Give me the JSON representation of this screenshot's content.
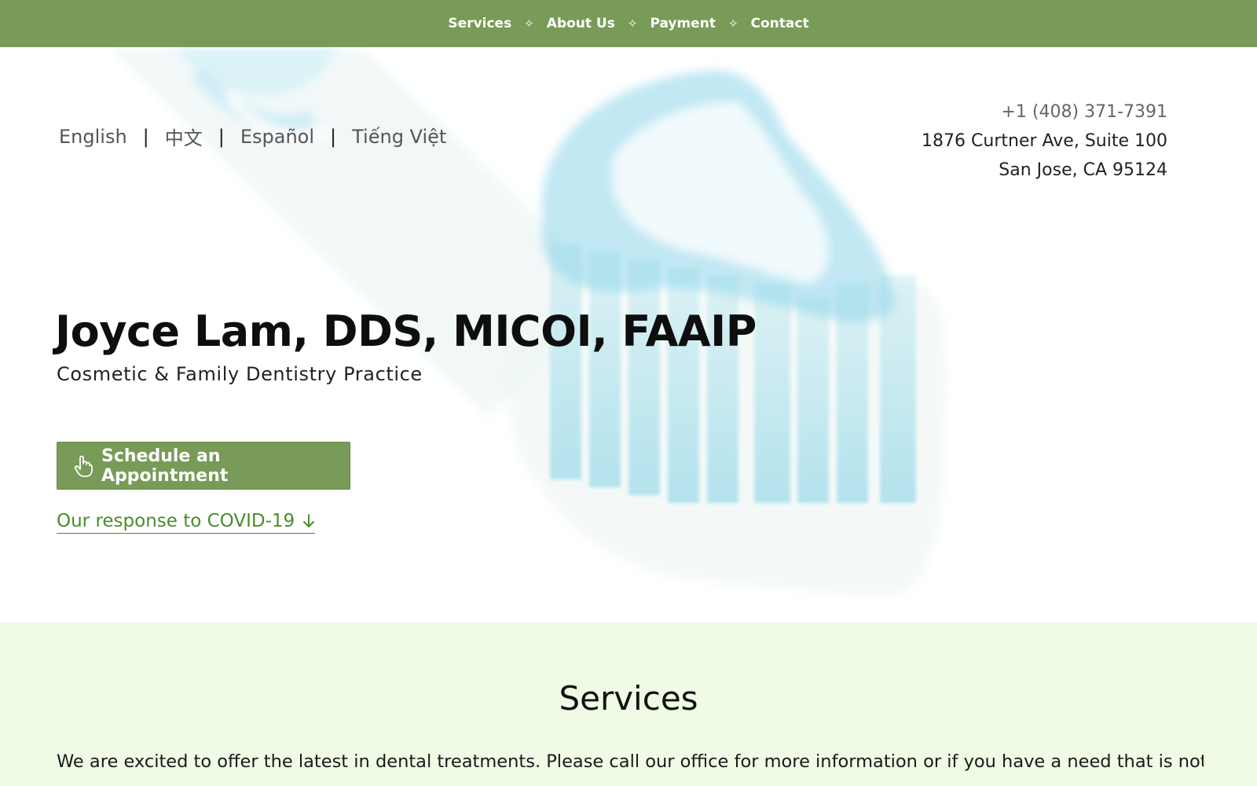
{
  "nav": {
    "items": [
      {
        "label": "Services"
      },
      {
        "label": "About Us"
      },
      {
        "label": "Payment"
      },
      {
        "label": "Contact"
      }
    ],
    "separator": "✧"
  },
  "languages": {
    "items": [
      {
        "label": "English"
      },
      {
        "label": "中文"
      },
      {
        "label": "Español"
      },
      {
        "label": "Tiếng Việt"
      }
    ],
    "separator": "|"
  },
  "contact": {
    "phone": "+1 (408) 371-7391",
    "address_line1": "1876 Curtner Ave, Suite 100",
    "address_line2": "San Jose, CA 95124"
  },
  "hero": {
    "title": "Joyce Lam, DDS, MICOI, FAAIP",
    "subtitle": "Cosmetic & Family Dentistry Practice",
    "cta_label": "Schedule an Appointment",
    "covid_link": "Our response to COVID-19",
    "background_icon": "toothbrush-image"
  },
  "services": {
    "heading": "Services",
    "intro": "We are excited to offer the latest in dental treatments. Please call our office for more information or if you have a need that is not listed"
  },
  "colors": {
    "brand_green": "#789b58",
    "link_green": "#4a8c2a",
    "section_bg": "#effbe4"
  }
}
